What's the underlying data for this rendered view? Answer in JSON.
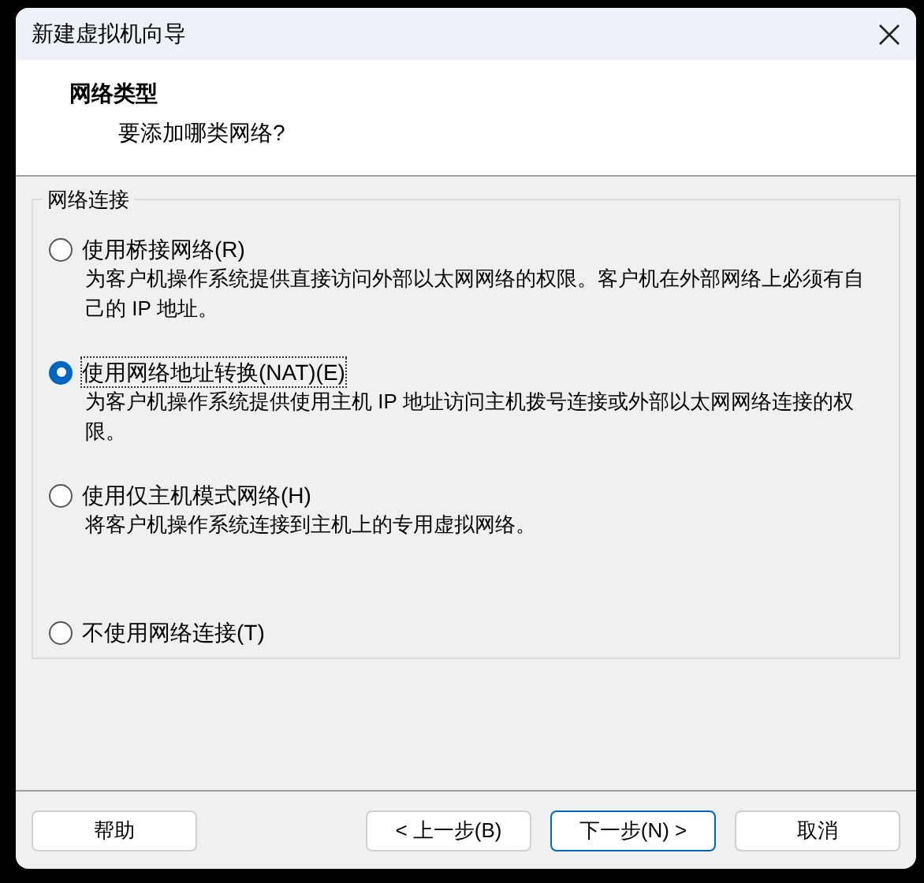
{
  "window": {
    "title": "新建虚拟机向导"
  },
  "header": {
    "title": "网络类型",
    "subtitle": "要添加哪类网络?"
  },
  "group": {
    "title": "网络连接",
    "options": [
      {
        "label": "使用桥接网络(R)",
        "description": "为客户机操作系统提供直接访问外部以太网网络的权限。客户机在外部网络上必须有自己的 IP 地址。",
        "selected": false
      },
      {
        "label": "使用网络地址转换(NAT)(E)",
        "description": "为客户机操作系统提供使用主机 IP 地址访问主机拨号连接或外部以太网网络连接的权限。",
        "selected": true
      },
      {
        "label": "使用仅主机模式网络(H)",
        "description": "将客户机操作系统连接到主机上的专用虚拟网络。",
        "selected": false
      },
      {
        "label": "不使用网络连接(T)",
        "selected": false
      }
    ]
  },
  "buttons": [
    {
      "label": "帮助",
      "kind": "help",
      "default": false
    },
    {
      "label": "< 上一步(B)",
      "kind": "nav",
      "default": false
    },
    {
      "label": "下一步(N) >",
      "kind": "nav",
      "default": true
    },
    {
      "label": "取消",
      "kind": "nav",
      "default": false
    }
  ]
}
